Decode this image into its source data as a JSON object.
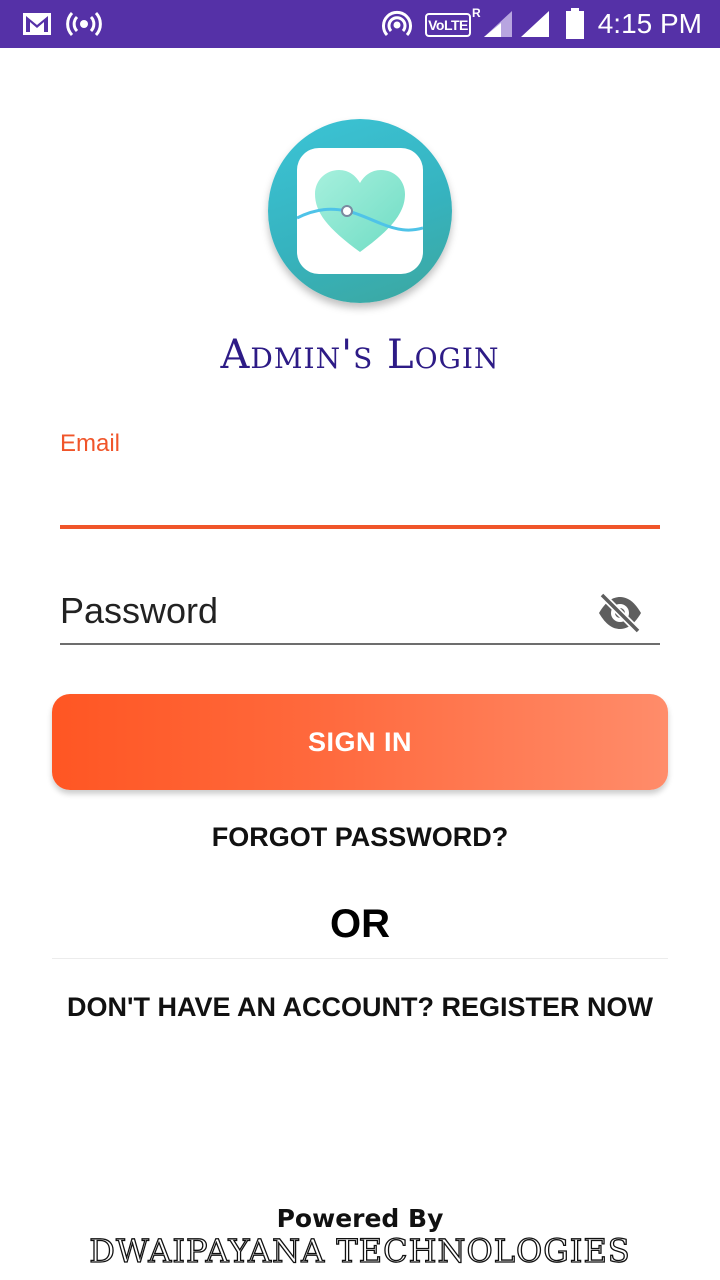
{
  "status_bar": {
    "time": "4:15 PM",
    "volte": "VoLTE",
    "volte_sup": "R",
    "icons": [
      "gmail-icon",
      "hotspot-icon",
      "nfc-icon",
      "signal-icon",
      "signal-icon",
      "battery-icon"
    ]
  },
  "app": {
    "title": "Admin's Login",
    "logo": "heart-app-logo"
  },
  "form": {
    "email_label": "Email",
    "email_value": "",
    "password_placeholder": "Password",
    "toggle_visibility_icon": "eye-off-icon",
    "sign_in_label": "SIGN IN",
    "forgot_label": "FORGOT PASSWORD?",
    "or_label": "OR",
    "register_label": "DON'T HAVE AN ACCOUNT? REGISTER NOW"
  },
  "footer": {
    "powered_by": "Powered By",
    "company": "DWAIPAYANA TECHNOLOGIES"
  },
  "colors": {
    "status_bar": "#5531a7",
    "accent": "#f0552a",
    "title": "#2d1b86",
    "button_start": "#ff5623",
    "button_end": "#ff8c6a"
  }
}
